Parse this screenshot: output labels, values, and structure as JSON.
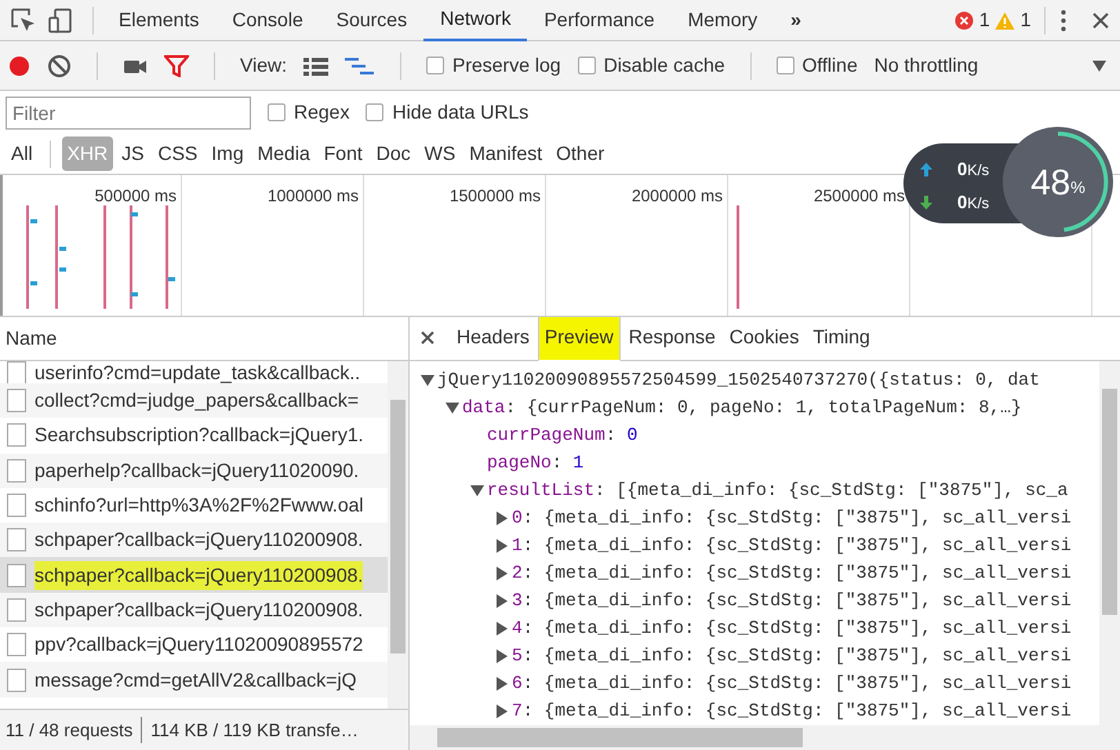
{
  "toolbar_tabs": [
    {
      "label": "Elements",
      "selected": false
    },
    {
      "label": "Console",
      "selected": false
    },
    {
      "label": "Sources",
      "selected": false
    },
    {
      "label": "Network",
      "selected": true
    },
    {
      "label": "Performance",
      "selected": false
    },
    {
      "label": "Memory",
      "selected": false
    }
  ],
  "overflow": "»",
  "errors": "1",
  "warnings": "1",
  "network_toolbar": {
    "recording": true,
    "view_label": "View:",
    "checkboxes": [
      {
        "label": "Preserve log",
        "checked": false
      },
      {
        "label": "Disable cache",
        "checked": false
      }
    ],
    "offline": {
      "label": "Offline",
      "checked": false
    },
    "throttling": "No throttling"
  },
  "filter": {
    "placeholder": "Filter",
    "options": [
      {
        "label": "Regex",
        "checked": false
      },
      {
        "label": "Hide data URLs",
        "checked": false
      }
    ]
  },
  "type_filters": [
    {
      "label": "All",
      "selected": false
    },
    {
      "label": "XHR",
      "selected": true
    },
    {
      "label": "JS",
      "selected": false
    },
    {
      "label": "CSS",
      "selected": false
    },
    {
      "label": "Img",
      "selected": false
    },
    {
      "label": "Media",
      "selected": false
    },
    {
      "label": "Font",
      "selected": false
    },
    {
      "label": "Doc",
      "selected": false
    },
    {
      "label": "WS",
      "selected": false
    },
    {
      "label": "Manifest",
      "selected": false
    },
    {
      "label": "Other",
      "selected": false
    }
  ],
  "overview": {
    "ticks": [
      "500000 ms",
      "1000000 ms",
      "1500000 ms",
      "2000000 ms",
      "2500000 ms"
    ]
  },
  "speed_meter": {
    "upload": {
      "value": "0",
      "unit": "K/s"
    },
    "download": {
      "value": "0",
      "unit": "K/s"
    },
    "percent": "48",
    "unit": "%",
    "level": 0.48
  },
  "requests": {
    "header": "Name",
    "rows": [
      {
        "name": "userinfo?cmd=update_task&callback..",
        "selected": false,
        "highlighted": false
      },
      {
        "name": "collect?cmd=judge_papers&callback=",
        "selected": false,
        "highlighted": false
      },
      {
        "name": "Searchsubscription?callback=jQuery1.",
        "selected": false,
        "highlighted": false
      },
      {
        "name": "paperhelp?callback=jQuery11020090.",
        "selected": false,
        "highlighted": false
      },
      {
        "name": "schinfo?url=http%3A%2F%2Fwww.oal",
        "selected": false,
        "highlighted": false
      },
      {
        "name": "schpaper?callback=jQuery110200908.",
        "selected": false,
        "highlighted": false
      },
      {
        "name": "schpaper?callback=jQuery110200908.",
        "selected": true,
        "highlighted": true
      },
      {
        "name": "schpaper?callback=jQuery110200908.",
        "selected": false,
        "highlighted": false
      },
      {
        "name": "ppv?callback=jQuery11020090895572",
        "selected": false,
        "highlighted": false
      },
      {
        "name": "message?cmd=getAllV2&callback=jQ",
        "selected": false,
        "highlighted": false
      }
    ]
  },
  "status_bar": {
    "requests": "11 / 48 requests",
    "transferred": "114 KB / 119 KB transfe…"
  },
  "detail_tabs": [
    {
      "label": "Headers",
      "selected": false,
      "highlighted": false
    },
    {
      "label": "Preview",
      "selected": true,
      "highlighted": true
    },
    {
      "label": "Response",
      "selected": false,
      "highlighted": false
    },
    {
      "label": "Cookies",
      "selected": false,
      "highlighted": false
    },
    {
      "label": "Timing",
      "selected": false,
      "highlighted": false
    }
  ],
  "preview": {
    "tree": [
      {
        "kind": "root",
        "key": "jQuery11020090895572504599_1502540737270",
        "summary": "({status: 0, dat",
        "expanded": true,
        "children": [
          {
            "kind": "object",
            "key": "data",
            "summary": ": {currPageNum: 0, pageNo: 1, totalPageNum: 8,…}",
            "expanded": true,
            "children": [
              {
                "kind": "number",
                "key": "currPageNum",
                "separator": ":",
                "value": "0"
              },
              {
                "kind": "number",
                "key": "pageNo",
                "separator": ":",
                "value": "1"
              },
              {
                "kind": "object",
                "key": "resultList",
                "summary": ": [{meta_di_info: {sc_StdStg: [\"3875\"], sc_a",
                "expanded": true,
                "children": [
                  {
                    "kind": "object",
                    "key": "0",
                    "summary": ": {meta_di_info: {sc_StdStg: [\"3875\"], sc_all_versi",
                    "expanded": false
                  },
                  {
                    "kind": "object",
                    "key": "1",
                    "summary": ": {meta_di_info: {sc_StdStg: [\"3875\"], sc_all_versi",
                    "expanded": false
                  },
                  {
                    "kind": "object",
                    "key": "2",
                    "summary": ": {meta_di_info: {sc_StdStg: [\"3875\"], sc_all_versi",
                    "expanded": false
                  },
                  {
                    "kind": "object",
                    "key": "3",
                    "summary": ": {meta_di_info: {sc_StdStg: [\"3875\"], sc_all_versi",
                    "expanded": false
                  },
                  {
                    "kind": "object",
                    "key": "4",
                    "summary": ": {meta_di_info: {sc_StdStg: [\"3875\"], sc_all_versi",
                    "expanded": false
                  },
                  {
                    "kind": "object",
                    "key": "5",
                    "summary": ": {meta_di_info: {sc_StdStg: [\"3875\"], sc_all_versi",
                    "expanded": false
                  },
                  {
                    "kind": "object",
                    "key": "6",
                    "summary": ": {meta_di_info: {sc_StdStg: [\"3875\"], sc_all_versi",
                    "expanded": false
                  },
                  {
                    "kind": "object",
                    "key": "7",
                    "summary": ": {meta_di_info: {sc_StdStg: [\"3875\"], sc_all_versi",
                    "expanded": false
                  }
                ]
              }
            ]
          }
        ]
      }
    ]
  }
}
